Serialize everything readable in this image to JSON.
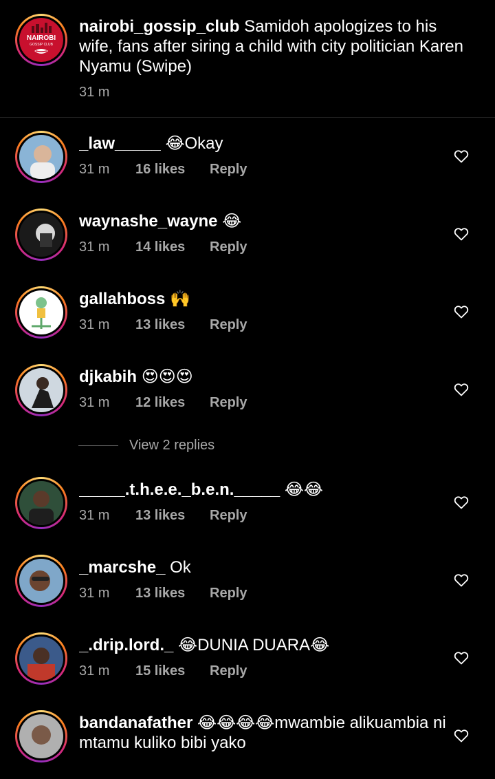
{
  "post": {
    "username": "nairobi_gossip_club",
    "caption": "Samidoh apologizes to his wife, fans after siring a child with city politician Karen Nyamu (Swipe)",
    "time": "31 m",
    "logo_text_main": "NAIROBI",
    "logo_text_sub": "GOSSIP CLUB"
  },
  "comments": [
    {
      "username": "_law_____",
      "text": "😂Okay",
      "time": "31 m",
      "likes": "16 likes",
      "reply": "Reply"
    },
    {
      "username": "waynashe_wayne",
      "text": "😂",
      "time": "31 m",
      "likes": "14 likes",
      "reply": "Reply"
    },
    {
      "username": "gallahboss",
      "text": "🙌",
      "time": "31 m",
      "likes": "13 likes",
      "reply": "Reply"
    },
    {
      "username": "djkabih",
      "text": "😍😍😍",
      "time": "31 m",
      "likes": "12 likes",
      "reply": "Reply"
    },
    {
      "username": "_____.t.h.e.e._b.e.n._____",
      "text": "😂😂",
      "time": "31 m",
      "likes": "13 likes",
      "reply": "Reply"
    },
    {
      "username": "_marcshe_",
      "text": "Ok",
      "time": "31 m",
      "likes": "13 likes",
      "reply": "Reply"
    },
    {
      "username": "_.drip.lord._",
      "text": "😂DUNIA DUARA😂",
      "time": "31 m",
      "likes": "15 likes",
      "reply": "Reply"
    },
    {
      "username": "bandanafather",
      "text": "😂😂😂😂mwambie alikuambia ni mtamu kuliko bibi yako",
      "time": "",
      "likes": "",
      "reply": ""
    }
  ],
  "view_replies": "View 2 replies",
  "colors": {
    "background": "#000000",
    "secondary_text": "#a8a8a8",
    "divider": "#262626"
  }
}
